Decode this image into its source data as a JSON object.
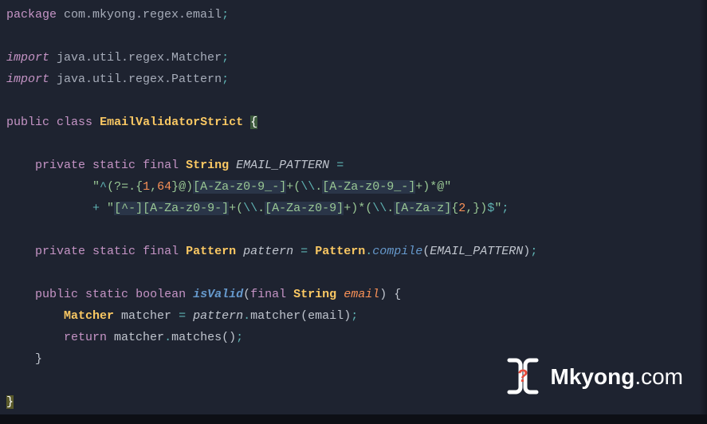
{
  "code": {
    "pkg_kw": "package",
    "pkg_name": "com.mkyong.regex.email",
    "import_kw": "import",
    "import1": "java.util.regex.Matcher",
    "import2": "java.util.regex.Pattern",
    "public_kw": "public",
    "class_kw": "class",
    "cls_name": "EmailValidatorStrict",
    "private_kw": "private",
    "static_kw": "static",
    "final_kw": "final",
    "string_type": "String",
    "pattern_type": "Pattern",
    "boolean_type": "boolean",
    "matcher_type": "Matcher",
    "email_pattern_const": "EMAIL_PATTERN",
    "regex_line1_open": "\"",
    "regex_caret": "^",
    "regex_l1_a": "(?=.",
    "regex_l1_b": "{",
    "regex_num1": "1",
    "regex_comma1": ",",
    "regex_num64": "64",
    "regex_l1_c": "}",
    "regex_l1_d": "@)",
    "regex_l1_brk1": "[A-Za-z0-9_-]",
    "regex_l1_e": "+(",
    "regex_esc": "\\\\",
    "regex_dot": ".",
    "regex_l1_brk2": "[A-Za-z0-9_-]",
    "regex_l1_f": "+)*@",
    "regex_line1_close": "\"",
    "plus_op": "+",
    "regex_line2_open": " \"",
    "regex_l2_brk1": "[^-]",
    "regex_l2_brk2": "[A-Za-z0-9-]",
    "regex_l2_a": "+(",
    "regex_l2_brk3": "[A-Za-z0-9]",
    "regex_l2_b": "+)*(",
    "regex_l2_brk4": "[A-Za-z]",
    "regex_l2_c": "{",
    "regex_num2": "2",
    "regex_comma2": ",",
    "regex_l2_d": "})",
    "regex_dollar": "$",
    "regex_line2_close": "\"",
    "pattern_field": "pattern",
    "compile_method": "compile",
    "isvalid_method": "isValid",
    "email_param": "email",
    "matcher_var": "matcher",
    "matcher_method": "matcher",
    "return_kw": "return",
    "matches_method": "matches"
  },
  "watermark": {
    "brand_bold": "Mkyong",
    "brand_rest": ".com",
    "icon_char": "?"
  }
}
